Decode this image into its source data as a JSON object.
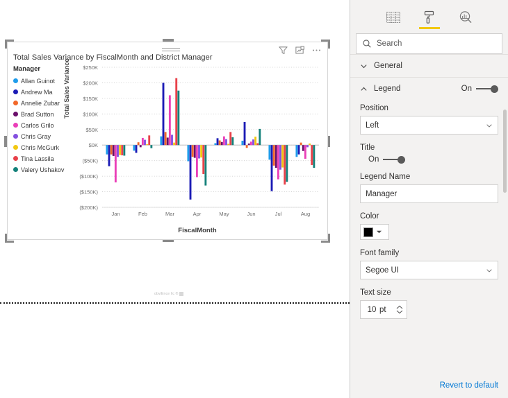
{
  "visual": {
    "title": "Total Sales Variance by FiscalMonth and District Manager",
    "header_icons": [
      {
        "name": "filter-icon",
        "label": "Filters"
      },
      {
        "name": "focus-mode-icon",
        "label": "Focus mode"
      },
      {
        "name": "more-options-icon",
        "label": "More options"
      }
    ],
    "drag_handle": "drag-handle-icon"
  },
  "canvas": {
    "watermark": "obviEnce llc ®"
  },
  "chart_data": {
    "type": "bar",
    "title": "Total Sales Variance by FiscalMonth and District Manager",
    "xlabel": "FiscalMonth",
    "ylabel": "Total Sales Variance",
    "legend_title": "Manager",
    "legend_position": "left",
    "grid": true,
    "categories": [
      "Jan",
      "Feb",
      "Mar",
      "Apr",
      "May",
      "Jun",
      "Jul",
      "Aug"
    ],
    "ylim": [
      -200000,
      250000
    ],
    "ytick_labels": [
      "$250K",
      "$200K",
      "$150K",
      "$100K",
      "$50K",
      "$0K",
      "($50K)",
      "($100K)",
      "($150K)",
      "($200K)"
    ],
    "ytick_values": [
      250000,
      200000,
      150000,
      100000,
      50000,
      0,
      -50000,
      -100000,
      -150000,
      -200000
    ],
    "series": [
      {
        "name": "Allan Guinot",
        "color": "#1f9ceb",
        "values": [
          -30000,
          -18000,
          28000,
          -52000,
          6000,
          14000,
          -47000,
          -38000
        ]
      },
      {
        "name": "Andrew Ma",
        "color": "#1b1bb5",
        "values": [
          -68000,
          -25000,
          200000,
          -175000,
          22000,
          74000,
          -148000,
          -30000
        ]
      },
      {
        "name": "Annelie Zubar",
        "color": "#f2682a",
        "values": [
          -30000,
          9000,
          42000,
          -38000,
          15000,
          -9000,
          -66000,
          8000
        ]
      },
      {
        "name": "Brad Sutton",
        "color": "#6b0f6b",
        "values": [
          -35000,
          -7000,
          24000,
          -41000,
          10000,
          5000,
          -73000,
          -19000
        ]
      },
      {
        "name": "Carlos Grilo",
        "color": "#ea3fb8",
        "values": [
          -120000,
          23000,
          160000,
          -103000,
          28000,
          11000,
          -110000,
          -44000
        ]
      },
      {
        "name": "Chris Gray",
        "color": "#8450e0",
        "values": [
          -38000,
          17000,
          33000,
          -43000,
          19000,
          18000,
          -79000,
          -7000
        ]
      },
      {
        "name": "Chris McGurk",
        "color": "#f2c811",
        "values": [
          -32000,
          3000,
          8000,
          -40000,
          4000,
          27000,
          -72000,
          5000
        ]
      },
      {
        "name": "Tina Lassila",
        "color": "#e8414a",
        "values": [
          -33000,
          31000,
          215000,
          -93000,
          42000,
          6000,
          -127000,
          -64000
        ]
      },
      {
        "name": "Valery Ushakov",
        "color": "#14817a",
        "values": [
          -34000,
          -10000,
          175000,
          -130000,
          25000,
          52000,
          -118000,
          -73000
        ]
      }
    ]
  },
  "format_pane": {
    "tabs": [
      {
        "name": "fields-tab",
        "icon": "fields-grid-icon",
        "label": "Fields",
        "active": false
      },
      {
        "name": "format-tab",
        "icon": "paint-roller-icon",
        "label": "Format",
        "active": true
      },
      {
        "name": "analytics-tab",
        "icon": "analytics-magnifier-icon",
        "label": "Analytics",
        "active": false
      }
    ],
    "search": {
      "value": "",
      "placeholder": "Search"
    },
    "sections": {
      "general": {
        "label": "General",
        "expanded": false
      },
      "legend": {
        "label": "Legend",
        "expanded": true,
        "toggle_state": "On"
      }
    },
    "fields": {
      "position": {
        "label": "Position",
        "value": "Left"
      },
      "title": {
        "label": "Title",
        "toggle_state": "On"
      },
      "legend_name": {
        "label": "Legend Name",
        "value": "Manager"
      },
      "color": {
        "label": "Color",
        "value": "#000000"
      },
      "font_family": {
        "label": "Font family",
        "value": "Segoe UI"
      },
      "text_size": {
        "label": "Text size",
        "value": "10",
        "unit": "pt"
      }
    },
    "revert_label": "Revert to default",
    "accent_color": "#f2c811",
    "link_color": "#0078d4"
  }
}
